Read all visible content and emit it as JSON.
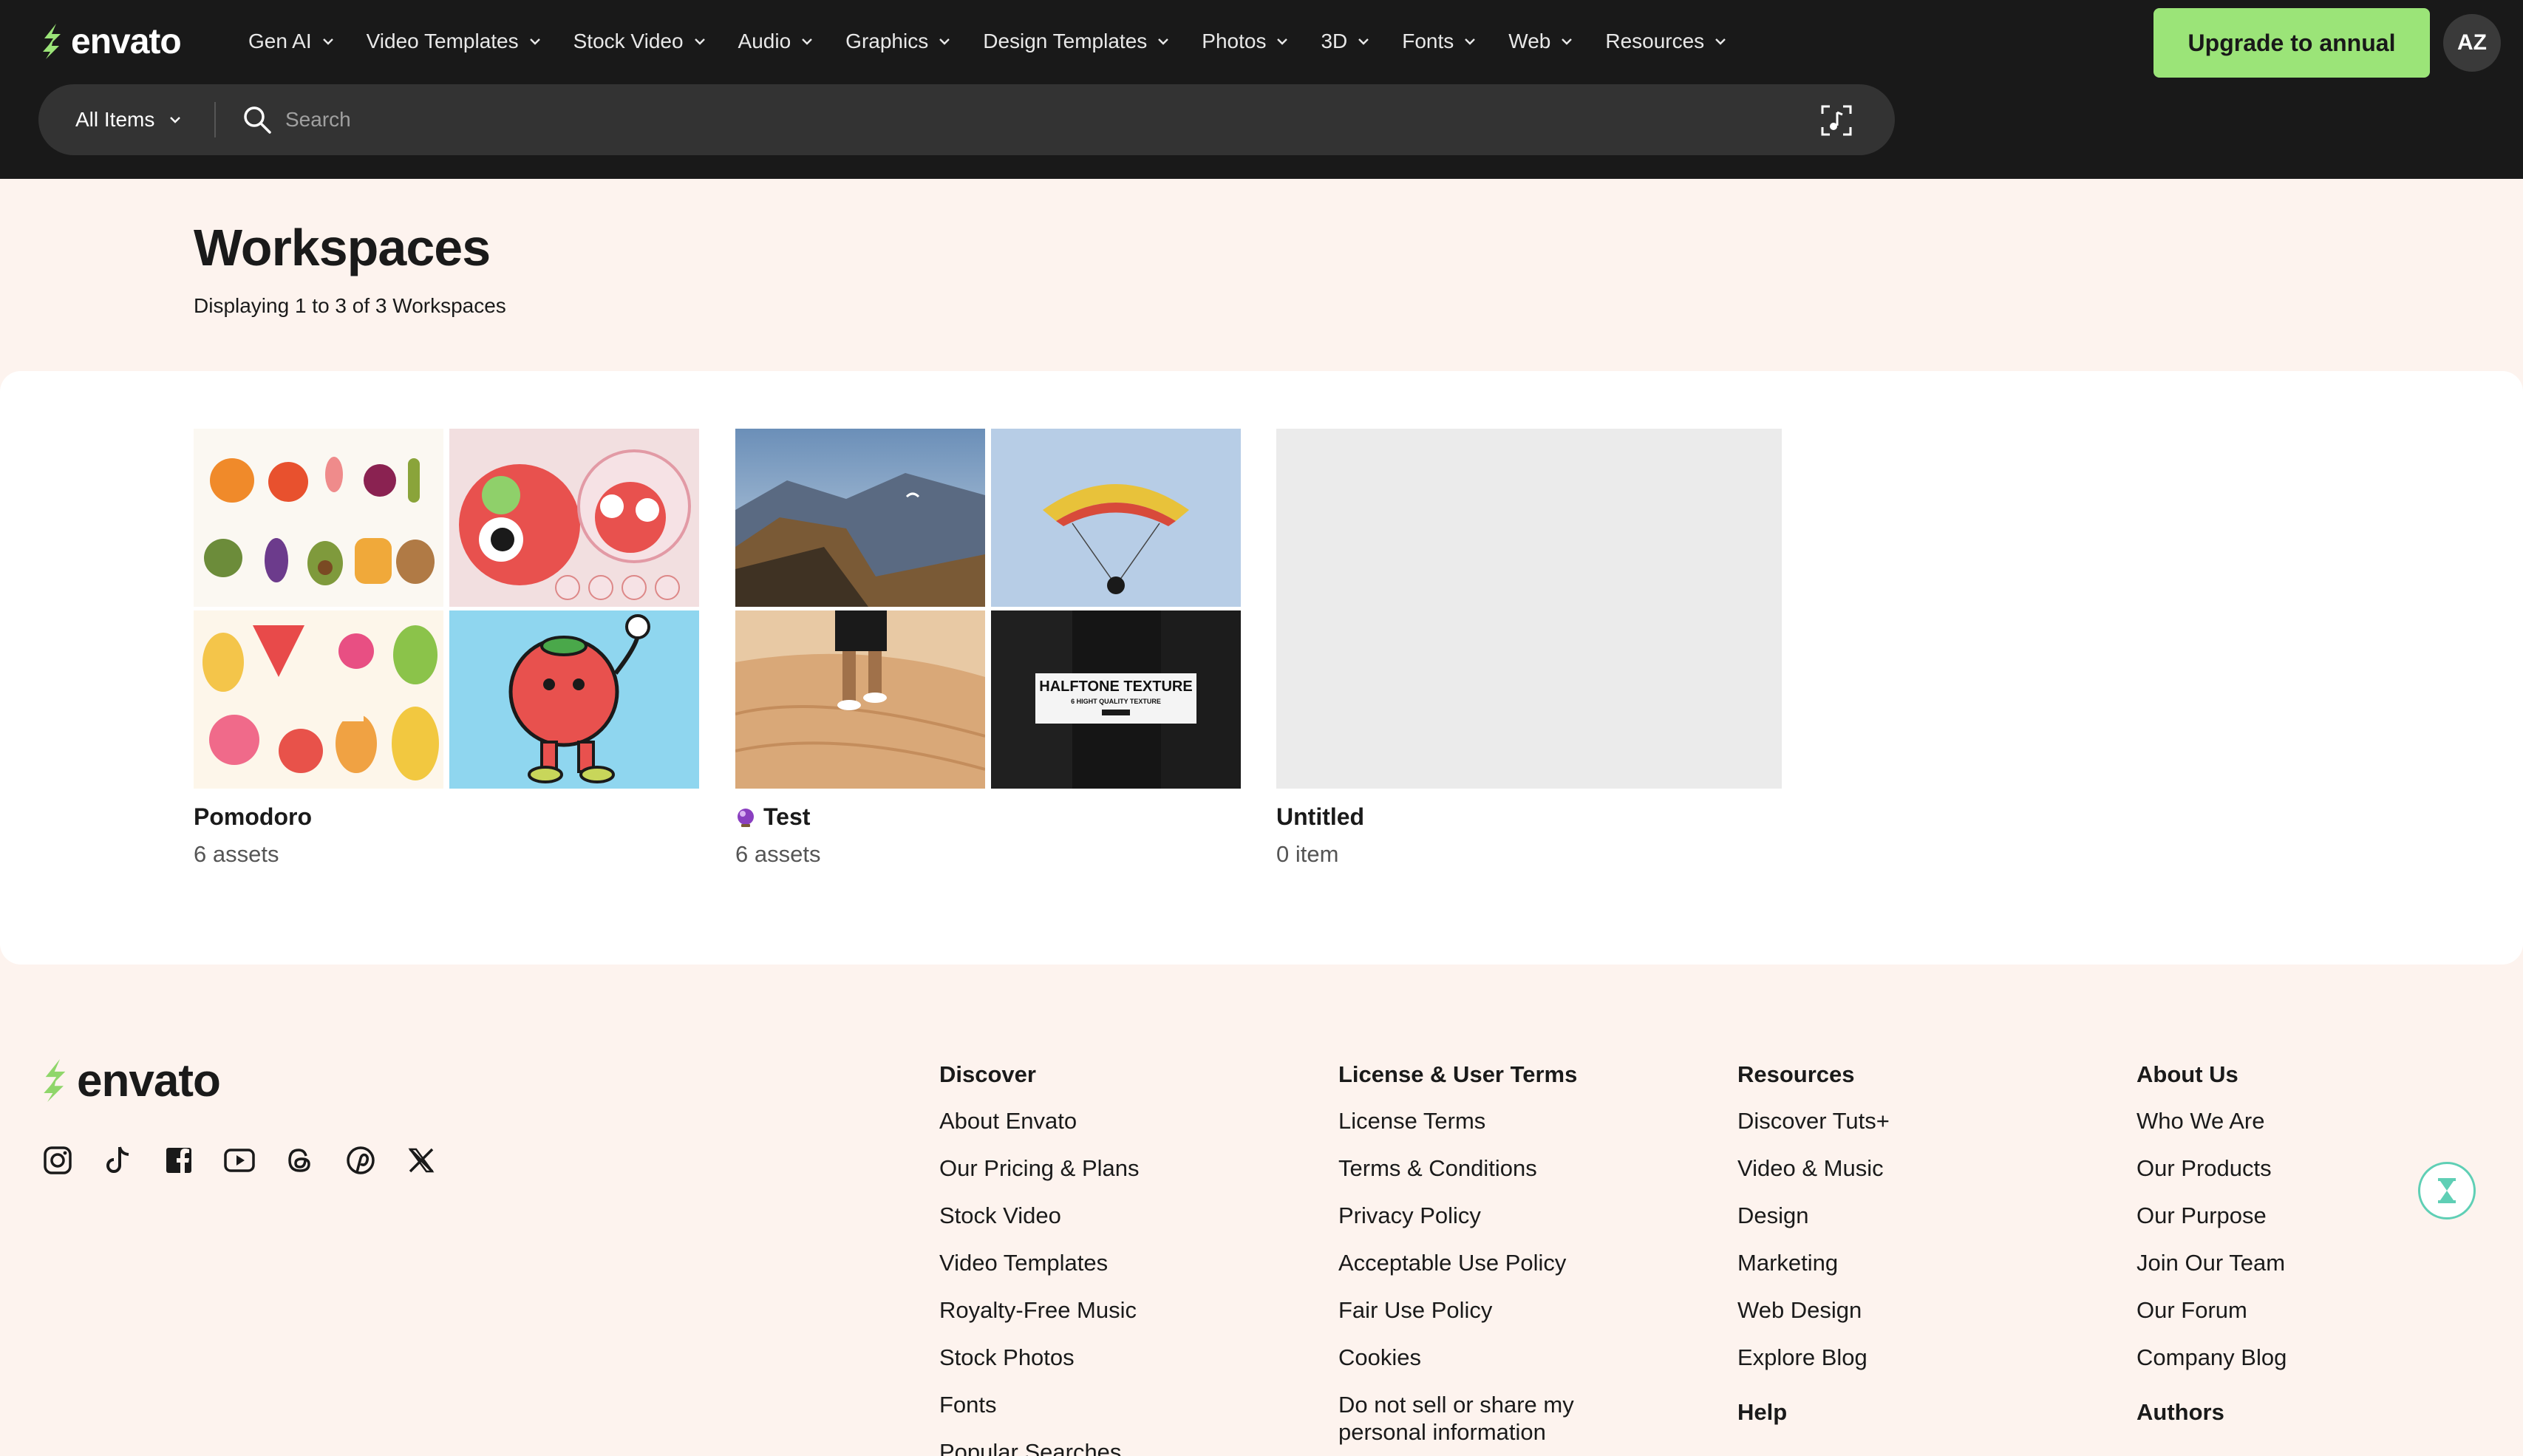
{
  "header": {
    "logo_text": "envato",
    "nav": [
      {
        "label": "Gen AI"
      },
      {
        "label": "Video Templates"
      },
      {
        "label": "Stock Video"
      },
      {
        "label": "Audio"
      },
      {
        "label": "Graphics"
      },
      {
        "label": "Design Templates"
      },
      {
        "label": "Photos"
      },
      {
        "label": "3D"
      },
      {
        "label": "Fonts"
      },
      {
        "label": "Web"
      },
      {
        "label": "Resources"
      }
    ],
    "upgrade_label": "Upgrade to annual",
    "avatar_initials": "AZ",
    "search": {
      "category": "All Items",
      "placeholder": "Search",
      "value": ""
    }
  },
  "page": {
    "title": "Workspaces",
    "subtitle": "Displaying 1 to 3 of 3 Workspaces"
  },
  "workspaces": [
    {
      "name": "Pomodoro",
      "count": "6 assets",
      "thumbnails": [
        "vegetable-characters",
        "tomato-stickers",
        "fruits-collection",
        "walking-tomato"
      ]
    },
    {
      "name": "Test",
      "count": "6 assets",
      "emoji": "purple-orb",
      "thumbnails": [
        "mountain-paraglider",
        "paraglider-sky",
        "desert-dunes-walker"
      ],
      "halftone_title": "HALFTONE TEXTURE",
      "halftone_sub": "6 HIGHT QUALITY TEXTURE"
    },
    {
      "name": "Untitled",
      "count": "0 item",
      "thumbnails": []
    }
  ],
  "footer": {
    "logo_text": "envato",
    "socials": [
      "instagram-icon",
      "tiktok-icon",
      "facebook-icon",
      "youtube-icon",
      "threads-icon",
      "pinterest-icon",
      "x-icon"
    ],
    "columns": [
      {
        "title": "Discover",
        "links": [
          "About Envato",
          "Our Pricing & Plans",
          "Stock Video",
          "Video Templates",
          "Royalty-Free Music",
          "Stock Photos",
          "Fonts",
          "Popular Searches"
        ]
      },
      {
        "title": "License & User Terms",
        "links": [
          "License Terms",
          "Terms & Conditions",
          "Privacy Policy",
          "Acceptable Use Policy",
          "Fair Use Policy",
          "Cookies",
          "Do not sell or share my personal information"
        ]
      },
      {
        "title": "Resources",
        "links": [
          "Discover Tuts+",
          "Video & Music",
          "Design",
          "Marketing",
          "Web Design",
          "Explore Blog"
        ],
        "next_title": "Help"
      },
      {
        "title": "About Us",
        "links": [
          "Who We Are",
          "Our Products",
          "Our Purpose",
          "Join Our Team",
          "Our Forum",
          "Company Blog"
        ],
        "next_title": "Authors"
      }
    ]
  },
  "colors": {
    "header_bg": "#191919",
    "accent_green": "#9be478",
    "page_bg": "#fdf3ee",
    "panel_bg": "#ffffff"
  }
}
